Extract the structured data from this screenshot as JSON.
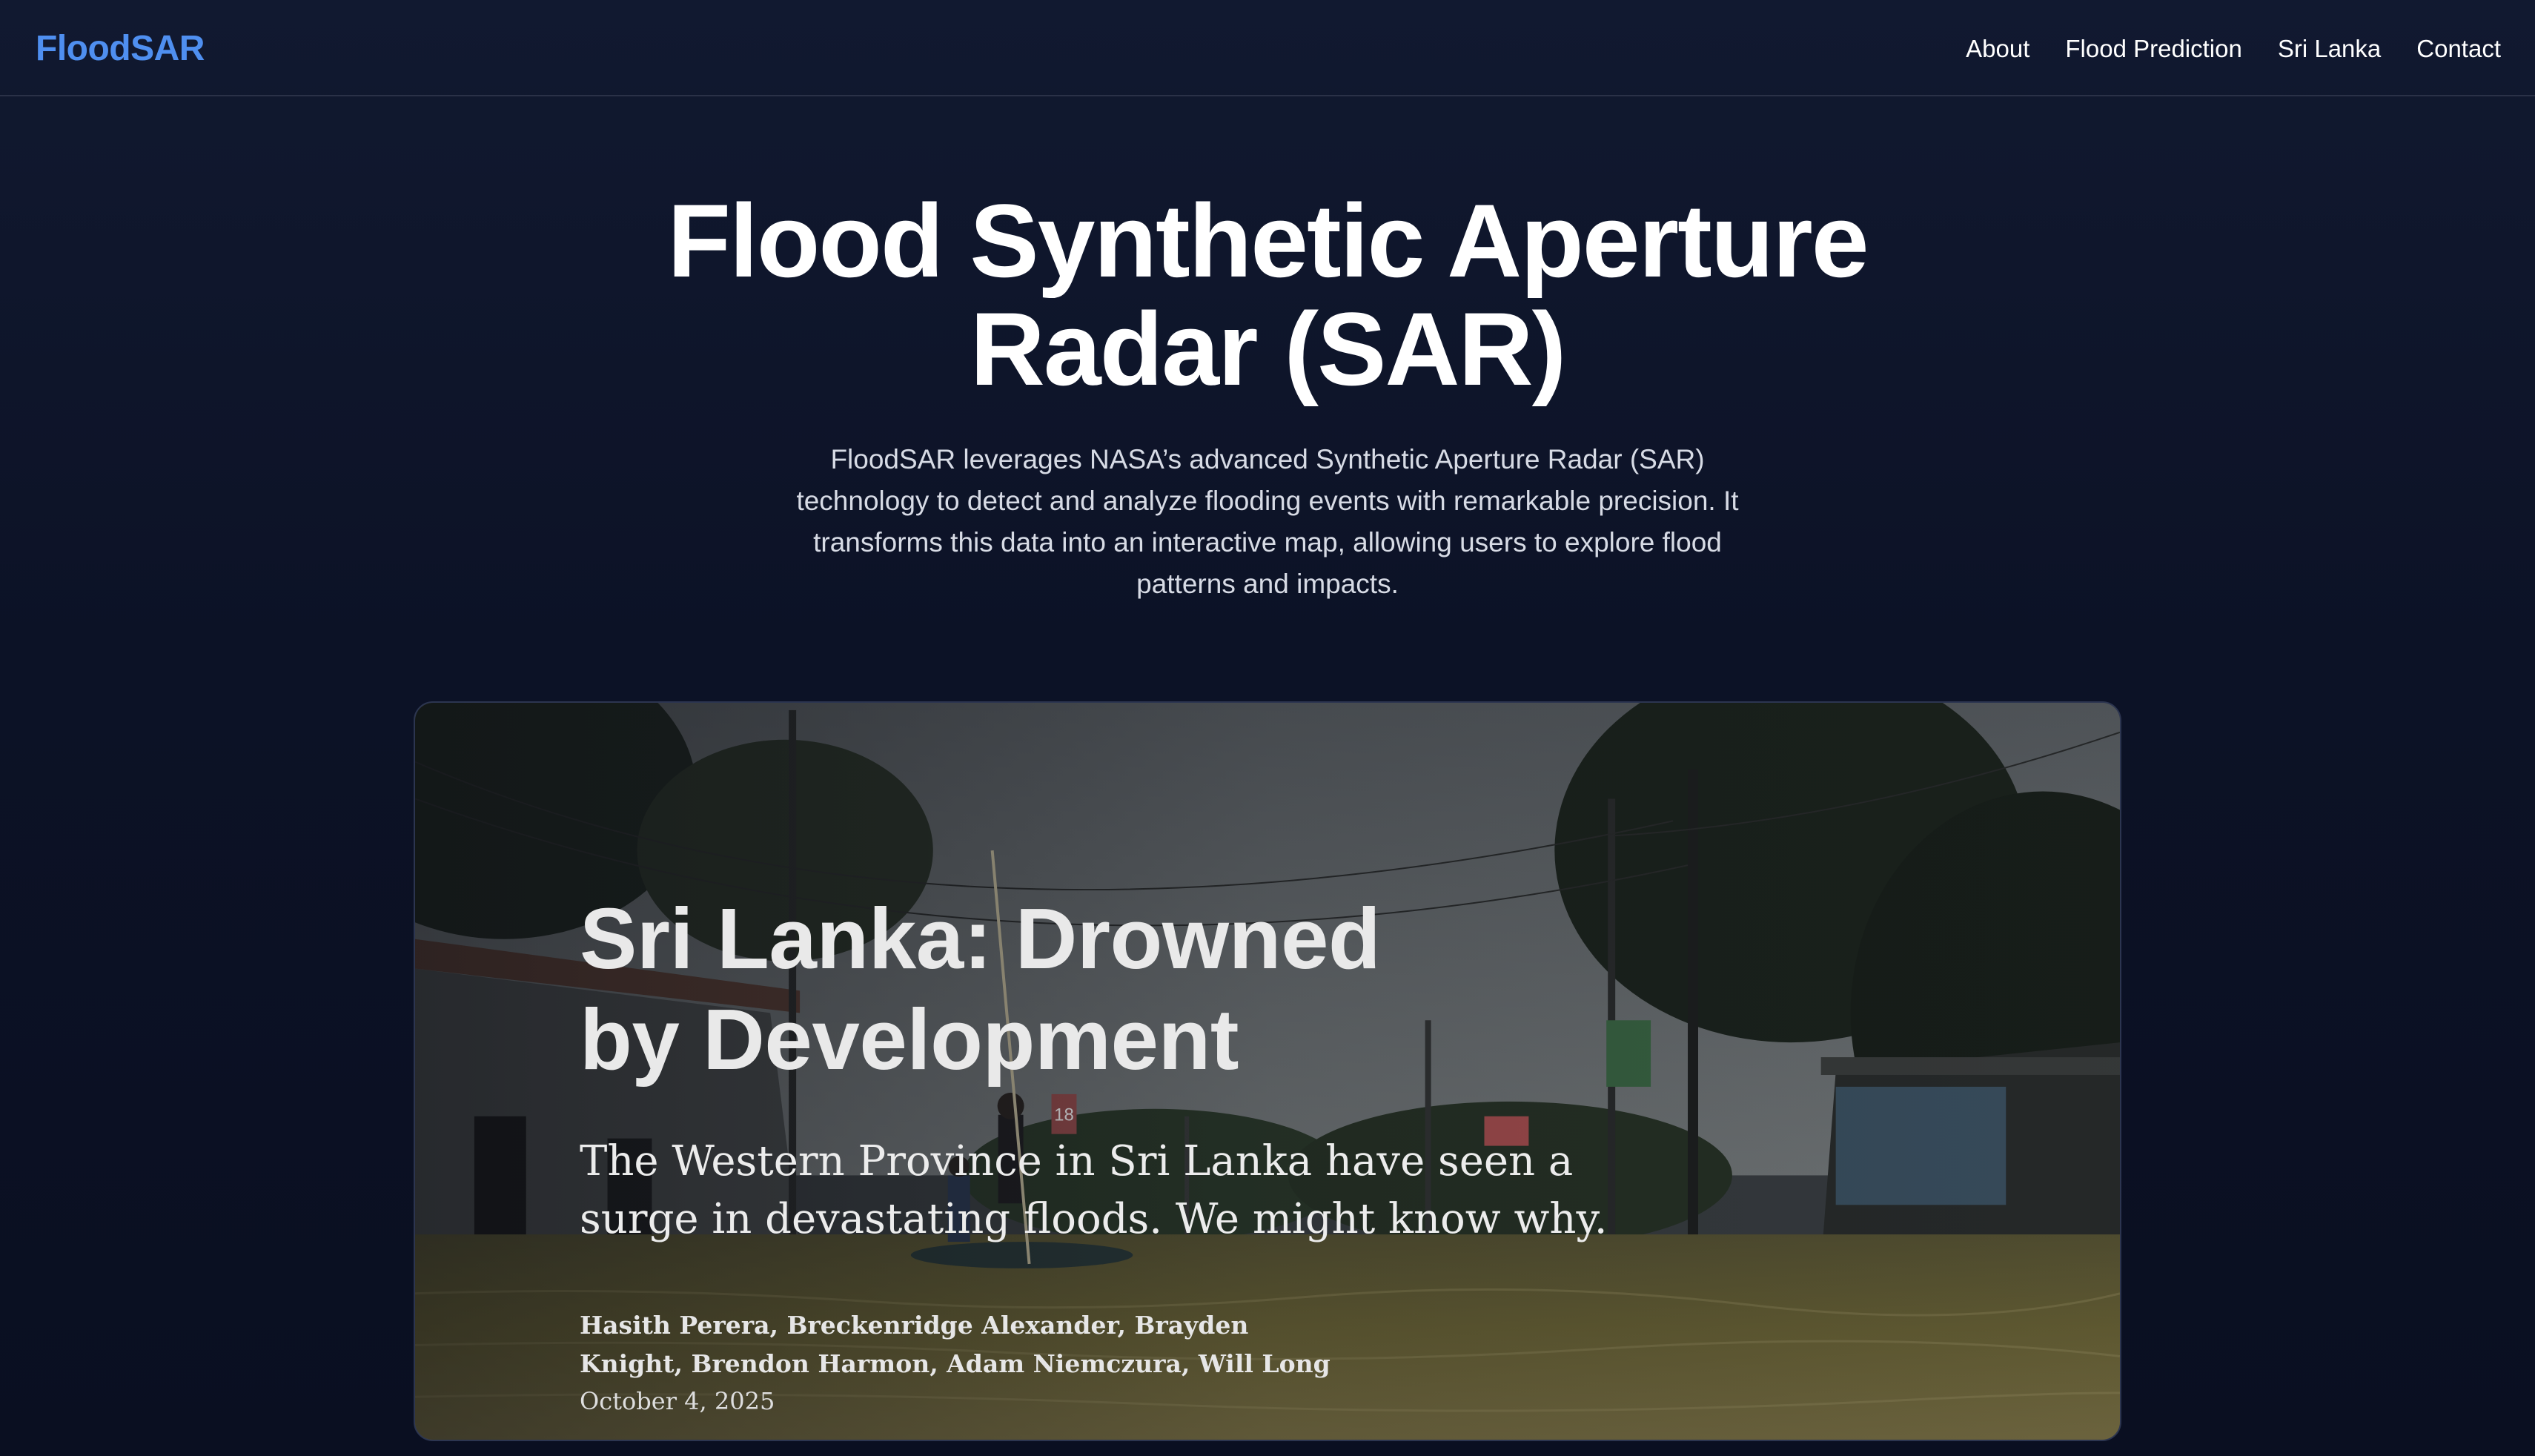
{
  "brand": "FloodSAR",
  "nav": {
    "items": [
      {
        "label": "About"
      },
      {
        "label": "Flood Prediction"
      },
      {
        "label": "Sri Lanka"
      },
      {
        "label": "Contact"
      }
    ]
  },
  "hero": {
    "title_line1": "Flood Synthetic Aperture",
    "title_line2": "Radar (SAR)",
    "description": "FloodSAR leverages NASA’s advanced Synthetic Aperture Radar (SAR) technology to detect and analyze flooding events with remarkable precision. It transforms this data into an interactive map, allowing users to explore flood patterns and impacts."
  },
  "feature": {
    "title_line1": "Sri Lanka: Drowned",
    "title_line2": "by Development",
    "subtitle": "The Western Province in Sri Lanka have seen a surge in devastating floods. We might know why.",
    "authors": "Hasith Perera, Breckenridge Alexander, Brayden Knight, Brendon Harmon, Adam Niemczura, Will Long",
    "date": "October 4, 2025",
    "sign_number": "18"
  },
  "colors": {
    "brand": "#4f8ff0",
    "background": "#0c1226",
    "text": "#ffffff",
    "muted_text": "#d7dbe5",
    "border": "#2a3147"
  }
}
